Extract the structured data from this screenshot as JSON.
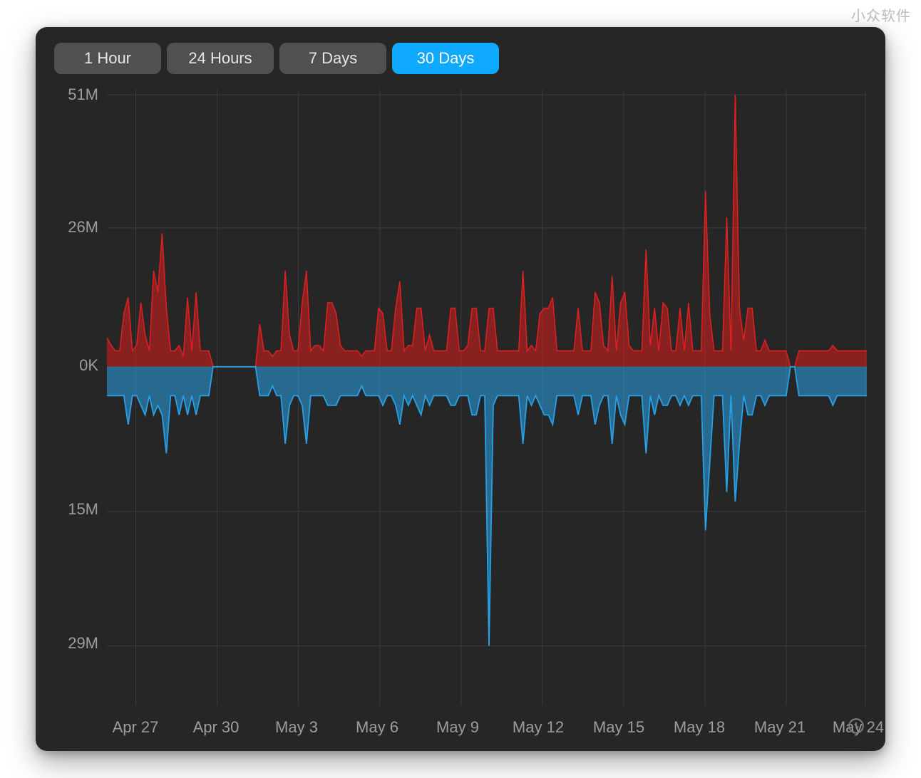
{
  "watermark": "小众软件",
  "tabs": [
    {
      "id": "t1",
      "label": "1 Hour",
      "active": false
    },
    {
      "id": "t2",
      "label": "24 Hours",
      "active": false
    },
    {
      "id": "t3",
      "label": "7 Days",
      "active": false
    },
    {
      "id": "t4",
      "label": "30 Days",
      "active": true
    }
  ],
  "chart_data": {
    "type": "area",
    "title": "",
    "xlabel": "",
    "ylabel": "",
    "y_ticks_up": [
      {
        "label": "51M",
        "value": 51000000
      },
      {
        "label": "26M",
        "value": 26000000
      },
      {
        "label": "0K",
        "value": 0
      }
    ],
    "y_ticks_down": [
      {
        "label": "15M",
        "value": -15000000
      },
      {
        "label": "29M",
        "value": -29000000
      }
    ],
    "x_ticks": [
      {
        "label": "Apr 27",
        "pos": 0.038
      },
      {
        "label": "Apr 30",
        "pos": 0.145
      },
      {
        "label": "May 3",
        "pos": 0.252
      },
      {
        "label": "May 6",
        "pos": 0.359
      },
      {
        "label": "May 9",
        "pos": 0.466
      },
      {
        "label": "May 12",
        "pos": 0.573
      },
      {
        "label": "May 15",
        "pos": 0.68
      },
      {
        "label": "May 18",
        "pos": 0.787
      },
      {
        "label": "May 21",
        "pos": 0.894
      },
      {
        "label": "May 24",
        "pos": 0.998
      }
    ],
    "ylim_up": [
      0,
      51000000
    ],
    "ylim_down": [
      0,
      -29000000
    ],
    "series": [
      {
        "name": "up",
        "color": "#e02020",
        "values": [
          5.5,
          4,
          3,
          3,
          10,
          13,
          3,
          4,
          12,
          6,
          3,
          18,
          14,
          25,
          11,
          3,
          3,
          4,
          2,
          13,
          3,
          14,
          3,
          3,
          3,
          0,
          0,
          0,
          0,
          0,
          0,
          0,
          0,
          0,
          0,
          0,
          8,
          3,
          3,
          2,
          3,
          3,
          18,
          6,
          3,
          3,
          12,
          18,
          3,
          4,
          4,
          3,
          12,
          12,
          10,
          4,
          3,
          3,
          3,
          3,
          2,
          3,
          3,
          3,
          11,
          10,
          3,
          3,
          11,
          16,
          3,
          4,
          4,
          11,
          11,
          3,
          6,
          3,
          3,
          3,
          3,
          11,
          11,
          3,
          3,
          4,
          11,
          11,
          3,
          3,
          11,
          11,
          3,
          3,
          3,
          3,
          3,
          3,
          18,
          3,
          4,
          3,
          10,
          11,
          11,
          13,
          3,
          3,
          3,
          3,
          3,
          11,
          3,
          3,
          3,
          14,
          12,
          4,
          3,
          17,
          3,
          12,
          14,
          4,
          3,
          3,
          3,
          22,
          4,
          11,
          3,
          12,
          11,
          3,
          3,
          11,
          3,
          12,
          3,
          3,
          3,
          33,
          10,
          3,
          3,
          3,
          28,
          3,
          51,
          11,
          5,
          11,
          11,
          3,
          3,
          5,
          3,
          3,
          3,
          3,
          3,
          0,
          0,
          3,
          3,
          3,
          3,
          3,
          3,
          3,
          3,
          4,
          3,
          3,
          3,
          3,
          3,
          3,
          3,
          3
        ]
      },
      {
        "name": "down",
        "color": "#28a0e6",
        "values": [
          3,
          3,
          3,
          3,
          3,
          6,
          3,
          3,
          4,
          5,
          3,
          5,
          4,
          5,
          9,
          3,
          3,
          5,
          3,
          5,
          3,
          5,
          3,
          3,
          3,
          0,
          0,
          0,
          0,
          0,
          0,
          0,
          0,
          0,
          0,
          0,
          3,
          3,
          3,
          2,
          3,
          3,
          8,
          4,
          3,
          3,
          4,
          8,
          3,
          3,
          3,
          3,
          4,
          4,
          4,
          3,
          3,
          3,
          3,
          3,
          2,
          3,
          3,
          3,
          3,
          4,
          3,
          3,
          4,
          6,
          3,
          4,
          3,
          4,
          5,
          3,
          4,
          3,
          3,
          3,
          3,
          4,
          4,
          3,
          3,
          3,
          5,
          5,
          3,
          3,
          29,
          4,
          3,
          3,
          3,
          3,
          3,
          3,
          8,
          3,
          4,
          3,
          4,
          5,
          5,
          6,
          3,
          3,
          3,
          3,
          3,
          5,
          3,
          3,
          3,
          6,
          4,
          3,
          3,
          8,
          3,
          5,
          6,
          3,
          3,
          3,
          3,
          9,
          3,
          5,
          3,
          4,
          4,
          3,
          3,
          4,
          3,
          4,
          3,
          3,
          3,
          17,
          10,
          3,
          3,
          3,
          13,
          3,
          14,
          8,
          3,
          5,
          5,
          3,
          3,
          4,
          3,
          3,
          3,
          3,
          3,
          0,
          0,
          3,
          3,
          3,
          3,
          3,
          3,
          3,
          3,
          4,
          3,
          3,
          3,
          3,
          3,
          3,
          3,
          3
        ]
      }
    ]
  }
}
